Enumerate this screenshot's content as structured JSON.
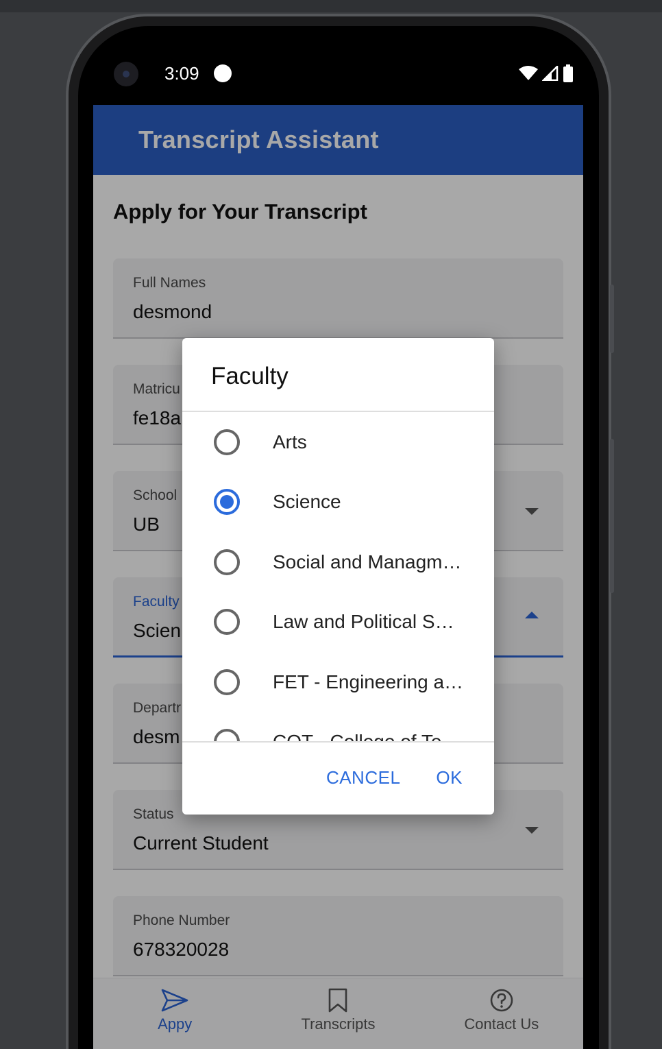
{
  "status_bar": {
    "time": "3:09"
  },
  "app": {
    "title": "Transcript Assistant"
  },
  "page": {
    "title": "Apply for Your Transcript"
  },
  "form": {
    "full_names": {
      "label": "Full Names",
      "value": "desmond"
    },
    "matricule": {
      "label": "Matricu",
      "value": "fe18a"
    },
    "school": {
      "label": "School",
      "value": "UB"
    },
    "faculty": {
      "label": "Faculty",
      "value": "Scien"
    },
    "department": {
      "label": "Departr",
      "value": "desm"
    },
    "status": {
      "label": "Status",
      "value": "Current Student"
    },
    "phone": {
      "label": "Phone Number",
      "value": "678320028"
    }
  },
  "dialog": {
    "title": "Faculty",
    "options": [
      {
        "label": "Arts",
        "selected": false
      },
      {
        "label": "Science",
        "selected": true
      },
      {
        "label": "Social and Managm…",
        "selected": false
      },
      {
        "label": "Law and Political S…",
        "selected": false
      },
      {
        "label": "FET - Engineering a…",
        "selected": false
      },
      {
        "label": "COT - College of Te…",
        "selected": false
      }
    ],
    "cancel_label": "CANCEL",
    "ok_label": "OK"
  },
  "bottom_nav": {
    "items": [
      {
        "label": "Appy",
        "icon": "send-icon",
        "active": true
      },
      {
        "label": "Transcripts",
        "icon": "bookmark-icon",
        "active": false
      },
      {
        "label": "Contact Us",
        "icon": "help-icon",
        "active": false
      }
    ]
  },
  "colors": {
    "primary": "#2b5fc4",
    "accent": "#2b6bdc"
  }
}
